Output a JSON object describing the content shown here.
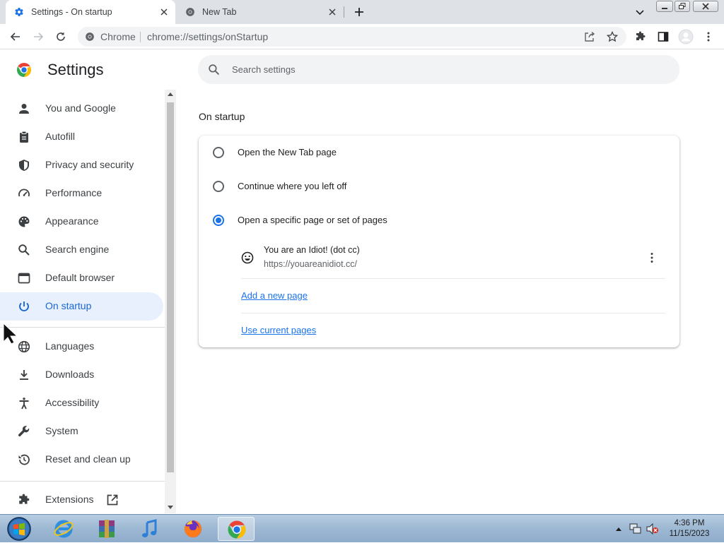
{
  "browser": {
    "tabs": [
      {
        "title": "Settings - On startup",
        "active": true
      },
      {
        "title": "New Tab",
        "active": false
      }
    ],
    "omnibox": {
      "chip": "Chrome",
      "url": "chrome://settings/onStartup"
    }
  },
  "settings": {
    "title": "Settings",
    "search_placeholder": "Search settings",
    "nav": {
      "you_and_google": "You and Google",
      "autofill": "Autofill",
      "privacy": "Privacy and security",
      "performance": "Performance",
      "appearance": "Appearance",
      "search_engine": "Search engine",
      "default_browser": "Default browser",
      "on_startup": "On startup",
      "languages": "Languages",
      "downloads": "Downloads",
      "accessibility": "Accessibility",
      "system": "System",
      "reset": "Reset and clean up",
      "extensions": "Extensions"
    },
    "on_startup": {
      "section_title": "On startup",
      "options": [
        {
          "label": "Open the New Tab page",
          "checked": false
        },
        {
          "label": "Continue where you left off",
          "checked": false
        },
        {
          "label": "Open a specific page or set of pages",
          "checked": true
        }
      ],
      "startup_page": {
        "title": "You are an Idiot! (dot cc)",
        "url": "https://youareanidiot.cc/"
      },
      "add_new_page": "Add a new page",
      "use_current_pages": "Use current pages"
    }
  },
  "taskbar": {
    "apps": [
      "internet-explorer",
      "winrar",
      "itunes",
      "firefox",
      "chrome"
    ],
    "active_app": "chrome",
    "clock": {
      "time": "4:36 PM",
      "date": "11/15/2023"
    }
  },
  "colors": {
    "accent": "#1a73e8",
    "nav_active_bg": "#e8f0fe",
    "tabstrip": "#dee1e6"
  }
}
